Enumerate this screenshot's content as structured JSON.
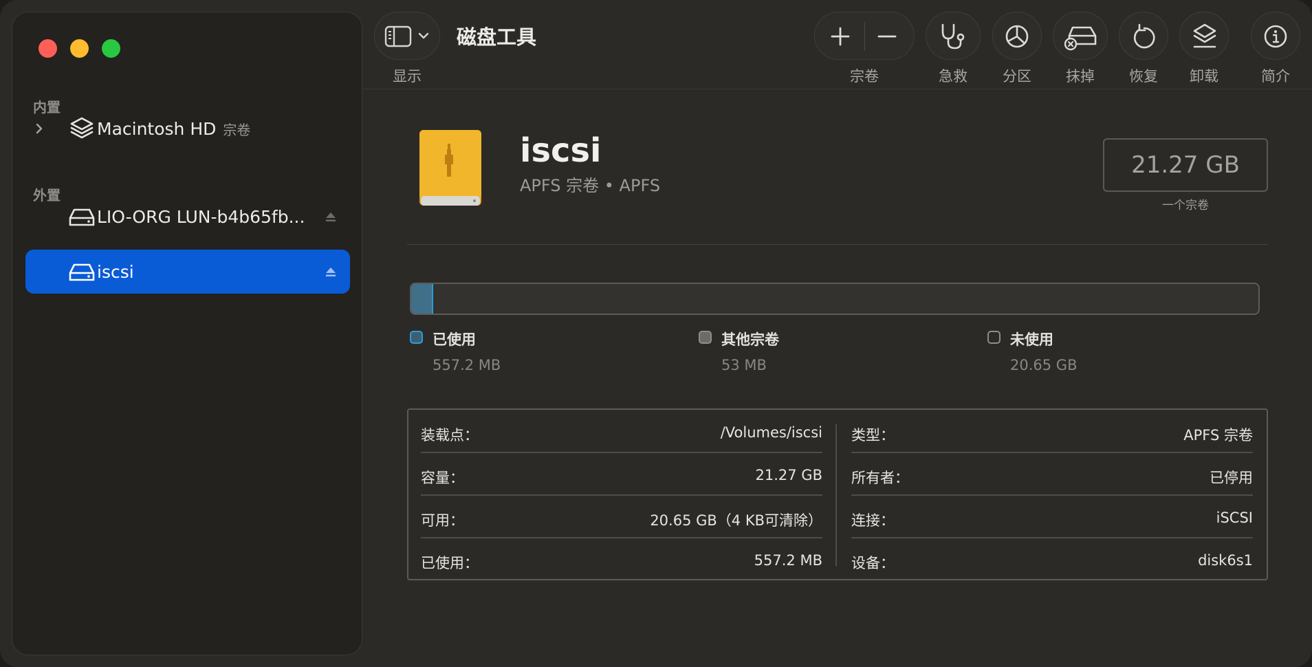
{
  "window": {
    "title": "磁盘工具"
  },
  "toolbar": {
    "view_label": "显示",
    "volume_label": "宗卷",
    "first_aid_label": "急救",
    "partition_label": "分区",
    "erase_label": "抹掉",
    "restore_label": "恢复",
    "unmount_label": "卸载",
    "info_label": "简介"
  },
  "sidebar": {
    "internal_label": "内置",
    "external_label": "外置",
    "internal_items": [
      {
        "label": "Macintosh HD",
        "sub": "宗卷",
        "icon": "layers-icon"
      }
    ],
    "external_items": [
      {
        "label": "LIO-ORG LUN-b4b65fb...",
        "icon": "external-drive-icon",
        "selected": false
      },
      {
        "label": "iscsi",
        "icon": "external-drive-icon",
        "selected": true
      }
    ]
  },
  "volume": {
    "name": "iscsi",
    "subtitle": "APFS 宗卷 • APFS",
    "capacity": "21.27 GB",
    "capacity_sub": "一个宗卷",
    "icon": "yellow-external-disk-icon"
  },
  "usage": {
    "used_fraction": 0.026,
    "legend": [
      {
        "label": "已使用",
        "value": "557.2 MB",
        "color": "#2a9ed8"
      },
      {
        "label": "其他宗卷",
        "value": "53 MB",
        "color": "#8e8d89"
      },
      {
        "label": "未使用",
        "value": "20.65 GB",
        "color": "#2b2a27"
      }
    ]
  },
  "info": {
    "left": [
      {
        "k": "装载点：",
        "v": "/Volumes/iscsi"
      },
      {
        "k": "容量：",
        "v": "21.27 GB"
      },
      {
        "k": "可用：",
        "v": "20.65 GB（4 KB可清除）"
      },
      {
        "k": "已使用：",
        "v": "557.2 MB"
      }
    ],
    "right": [
      {
        "k": "类型：",
        "v": "APFS 宗卷"
      },
      {
        "k": "所有者：",
        "v": "已停用"
      },
      {
        "k": "连接：",
        "v": "iSCSI"
      },
      {
        "k": "设备：",
        "v": "disk6s1"
      }
    ]
  },
  "colors": {
    "accent": "#0a5bd6",
    "used": "#2a9ed8",
    "close": "#ff5f57",
    "minimize": "#febc2e",
    "maximize": "#28c840"
  }
}
